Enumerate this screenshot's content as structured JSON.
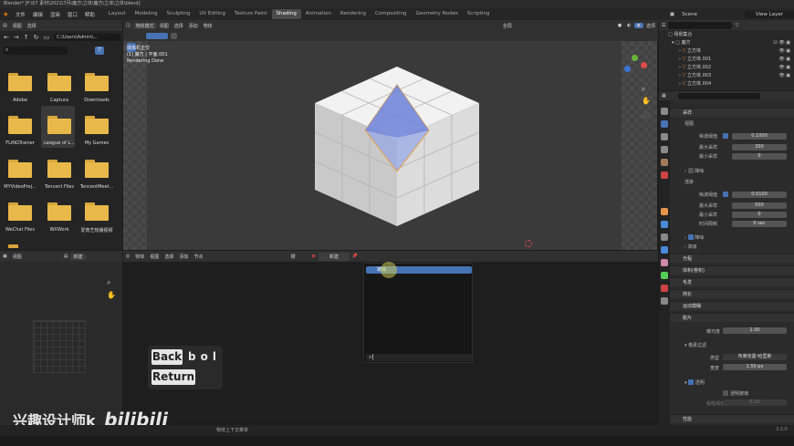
{
  "window": {
    "title": "Blender* [F:\\07 素材\\2021\\7月\\魔方\\立体\\魔方\\立体\\立体\\blend]"
  },
  "menu": [
    "文件",
    "编辑",
    "渲染",
    "窗口",
    "帮助"
  ],
  "workspaces": [
    "Layout",
    "Modeling",
    "Sculpting",
    "UV Editing",
    "Texture Paint",
    "Shading",
    "Animation",
    "Rendering",
    "Compositing",
    "Geometry Nodes",
    "Scripting"
  ],
  "active_workspace": "Shading",
  "scene": {
    "label": "Scene",
    "view_layer": "View Layer"
  },
  "file_browser": {
    "menu": [
      "视图",
      "选择"
    ],
    "path": "C:\\Users\\Admin\\...",
    "folders": [
      {
        "name": "Adobe"
      },
      {
        "name": "Captura"
      },
      {
        "name": "Downloads"
      },
      {
        "name": "FLiNGTrainer"
      },
      {
        "name": "League of L..."
      },
      {
        "name": "My Games"
      },
      {
        "name": "MYVideoProj..."
      },
      {
        "name": "Tencent Files"
      },
      {
        "name": "TencentMeet..."
      },
      {
        "name": "WeChat Files"
      },
      {
        "name": "WXWork"
      },
      {
        "name": "爱奇艺热播视频"
      }
    ]
  },
  "viewport": {
    "mode": "物体模式",
    "menu": [
      "视图",
      "选择",
      "添加",
      "物体"
    ],
    "transform": "全局",
    "info_line1": "摄像机正交",
    "info_line2": "(1) 魔方 | 平面.001",
    "info_line3": "Rendering Done",
    "options": "选项"
  },
  "outliner": {
    "root": "场景集合",
    "collection": "魔方",
    "items": [
      "立方体",
      "立方体.001",
      "立方体.002",
      "立方体.003",
      "立方体.004"
    ]
  },
  "properties": {
    "sampling": "采样",
    "viewport_group": "视图",
    "noise_threshold_label": "噪波阈值",
    "vp_noise_threshold": "0.1000",
    "max_samples_label": "最大采样",
    "vp_max_samples": "300",
    "min_samples_label": "最小采样",
    "vp_min_samples": "0",
    "denoise": "降噪",
    "render_group": "渲染",
    "r_noise_threshold": "0.0100",
    "r_max_samples": "500",
    "r_min_samples": "0",
    "time_limit_label": "时间限制",
    "r_time_limit": "0 sec",
    "r_denoise": "降噪",
    "advanced": "高级",
    "light_paths": "光程",
    "volumes": "体积(卷积)",
    "hair": "毛发",
    "simplify": "简化",
    "motion_blur": "运动模糊",
    "film": "胶片",
    "exposure_label": "曝光度",
    "exposure": "1.00",
    "pixel_filter": "像素过滤",
    "type_label": "类型",
    "type_value": "布莱克曼-哈里斯",
    "width_label": "宽度",
    "width_value": "1.50 px",
    "transparent": "透明",
    "transparent_glass": "透明玻璃",
    "roughness_label": "粗糙阈值",
    "roughness_value": "0.10",
    "performance": "性能"
  },
  "image_editor": {
    "menu": [
      "视图"
    ],
    "new_button": "新建"
  },
  "node_editor": {
    "object_label": "物体",
    "menu": [
      "视图",
      "选择",
      "添加",
      "节点"
    ],
    "slot": "槽",
    "new_button": "新建",
    "popup_item": "玻璃"
  },
  "keycast": {
    "key1": "Back",
    "key1_suffix": "bol",
    "key2": "Return"
  },
  "watermark": {
    "text": "兴趣设计师k",
    "logo": "bilibili"
  },
  "status": {
    "hint": "物体上下文菜单",
    "version": "3.0.0"
  },
  "colors": {
    "accent": "#4772b3",
    "folder": "#e8b94a",
    "bg": "#1d1d1d"
  }
}
